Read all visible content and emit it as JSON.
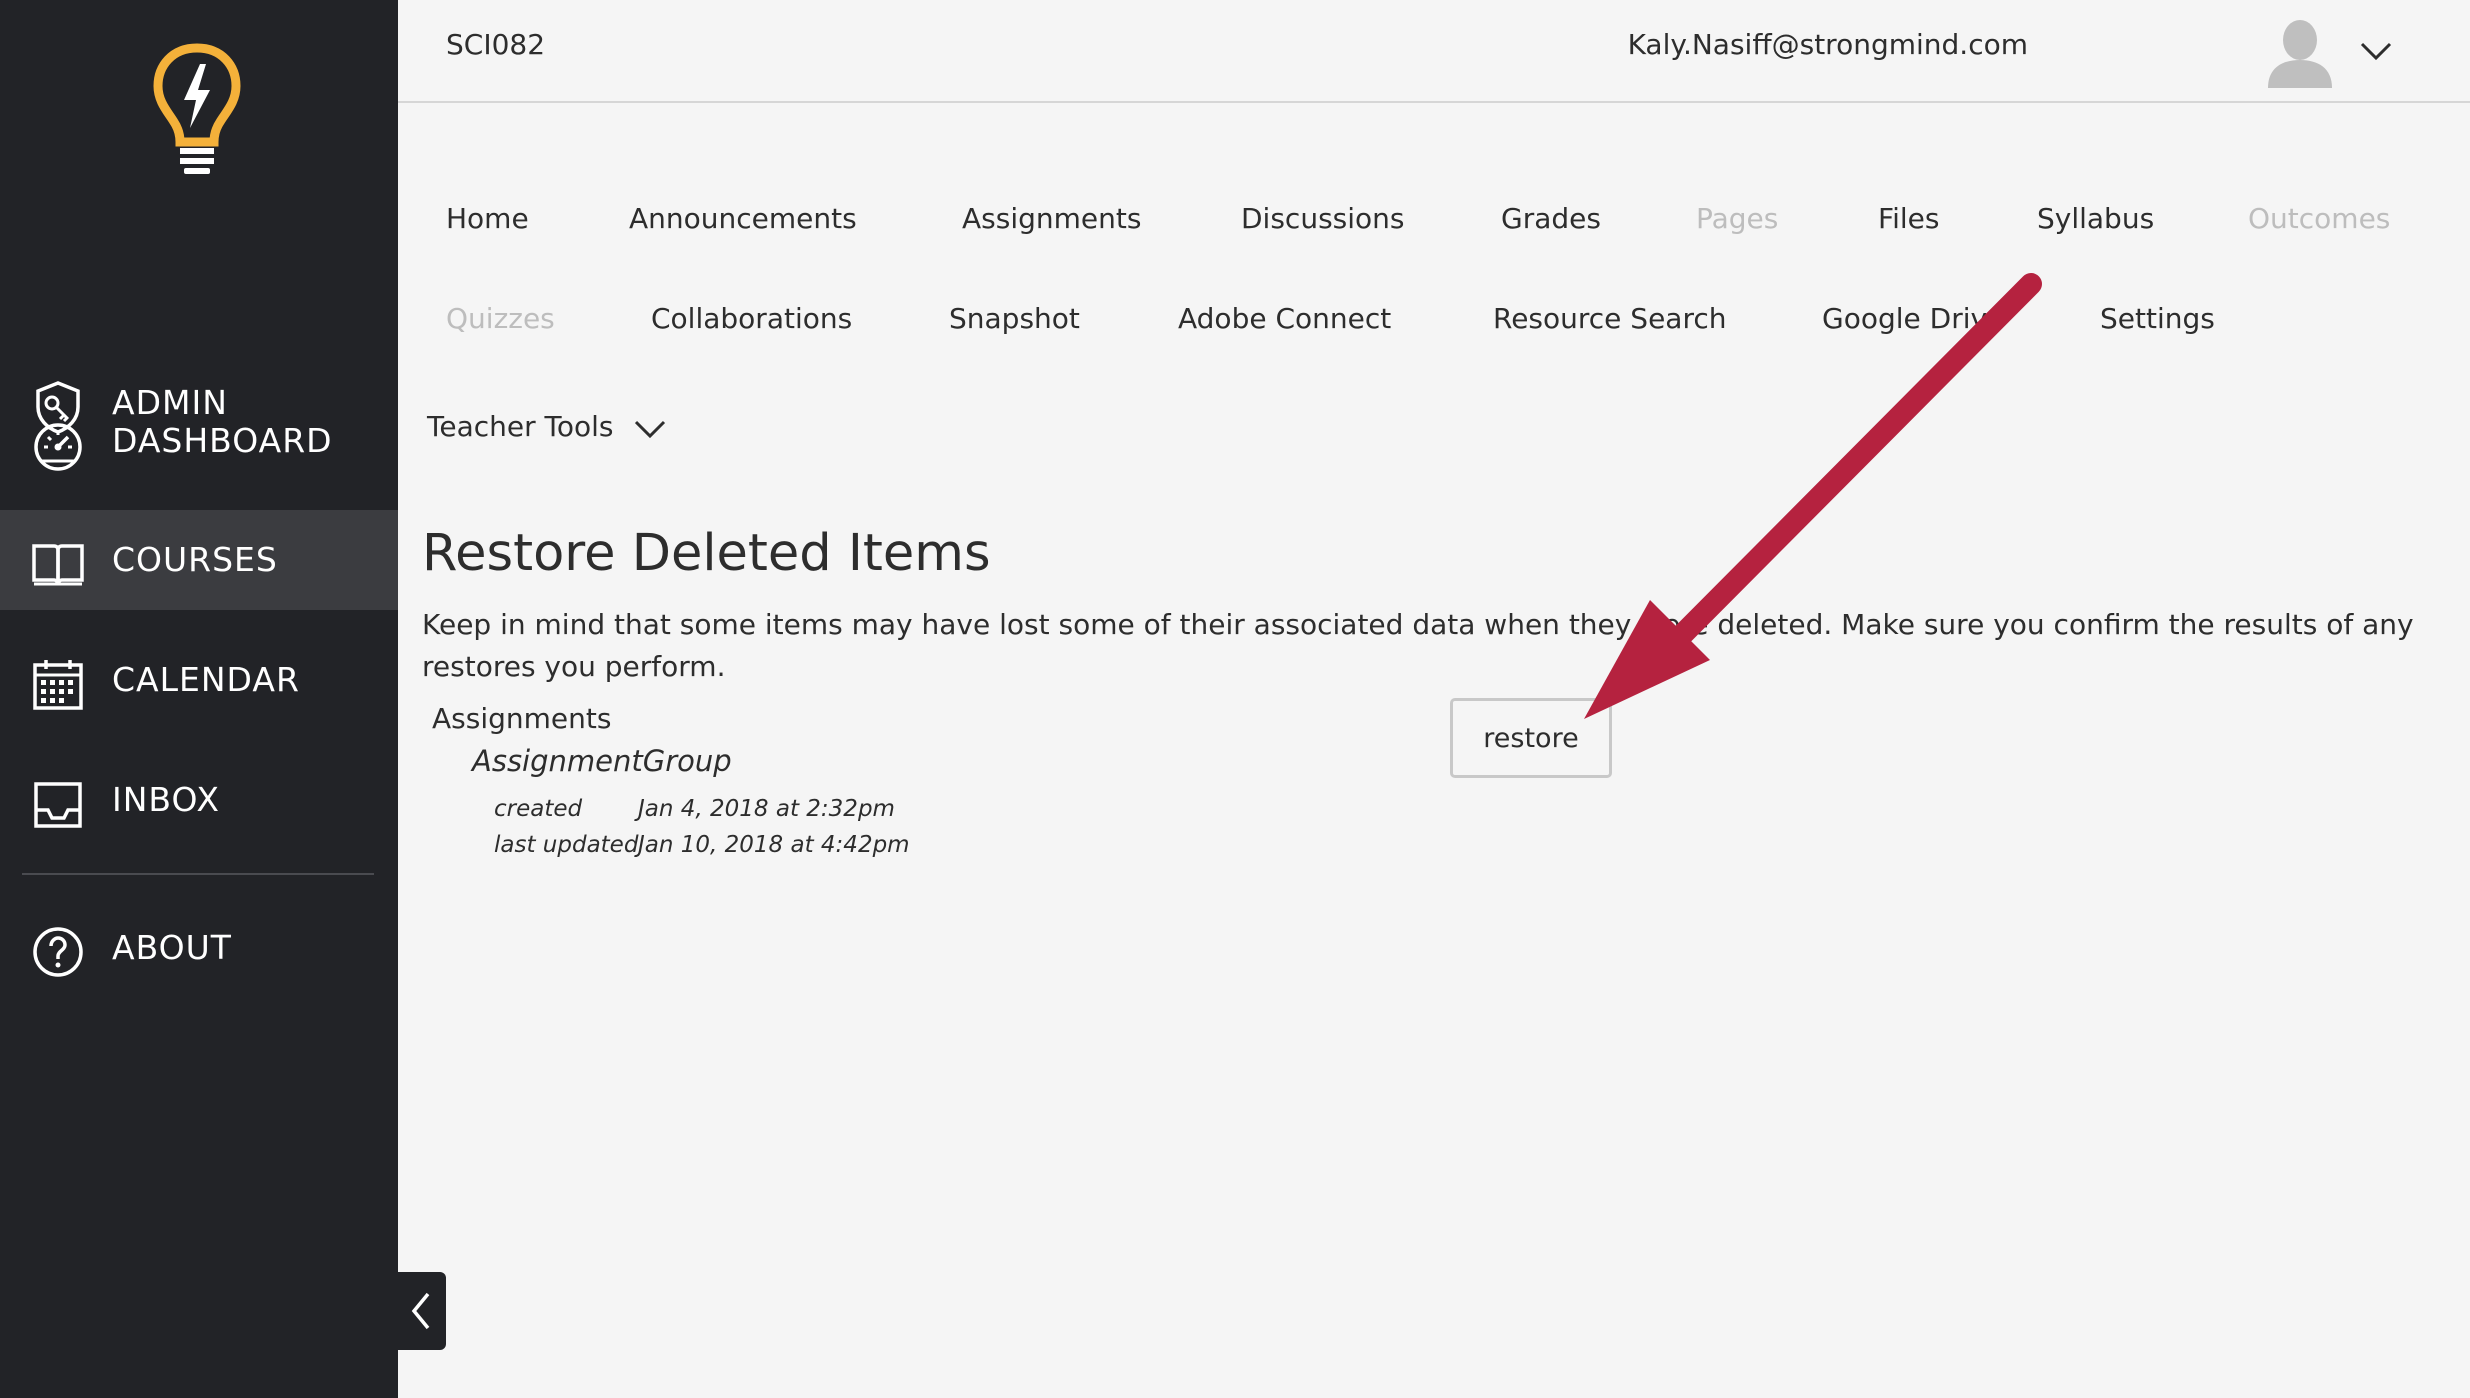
{
  "sidebar": {
    "items": [
      {
        "key": "admin",
        "label": "ADMIN",
        "icon": "shield-key-icon",
        "active": false
      },
      {
        "key": "dashboard",
        "label": "DASHBOARD",
        "icon": "speedometer-icon",
        "active": false
      },
      {
        "key": "courses",
        "label": "COURSES",
        "icon": "book-icon",
        "active": true
      },
      {
        "key": "calendar",
        "label": "CALENDAR",
        "icon": "calendar-icon",
        "active": false
      },
      {
        "key": "inbox",
        "label": "INBOX",
        "icon": "inbox-tray-icon",
        "active": false
      },
      {
        "key": "about",
        "label": "ABOUT",
        "icon": "question-circle-icon",
        "active": false
      }
    ],
    "logo_icon": "lightbulb-bolt-icon",
    "collapse_icon": "chevron-left-icon",
    "bg_color": "#222327",
    "active_bg_color": "#3b3c40",
    "logo_color": "#f4b13a"
  },
  "header": {
    "course_code": "SCI082",
    "user_email": "Kaly.Nasiff@strongmind.com",
    "avatar_icon": "user-silhouette-icon",
    "menu_icon": "chevron-down-icon"
  },
  "course_nav": {
    "row1": [
      {
        "label": "Home",
        "disabled": false
      },
      {
        "label": "Announcements",
        "disabled": false
      },
      {
        "label": "Assignments",
        "disabled": false
      },
      {
        "label": "Discussions",
        "disabled": false
      },
      {
        "label": "Grades",
        "disabled": false
      },
      {
        "label": "Pages",
        "disabled": true
      },
      {
        "label": "Files",
        "disabled": false
      },
      {
        "label": "Syllabus",
        "disabled": false
      },
      {
        "label": "Outcomes",
        "disabled": true
      }
    ],
    "row2": [
      {
        "label": "Quizzes",
        "disabled": true
      },
      {
        "label": "Collaborations",
        "disabled": false
      },
      {
        "label": "Snapshot",
        "disabled": false
      },
      {
        "label": "Adobe Connect",
        "disabled": false
      },
      {
        "label": "Resource Search",
        "disabled": false
      },
      {
        "label": "Google Drive",
        "disabled": false
      },
      {
        "label": "Settings",
        "disabled": false
      }
    ],
    "teacher_tools": "Teacher Tools"
  },
  "main": {
    "title": "Restore Deleted Items",
    "notice": "Keep in mind that some items may have lost some of their associated data when they were deleted. Make sure you confirm the results of any restores you perform.",
    "section": "Assignments",
    "item": {
      "name": "AssignmentGroup",
      "created_label": "created",
      "created_value": "Jan 4, 2018 at 2:32pm",
      "updated_label": "last updated",
      "updated_value": "Jan 10, 2018 at 4:42pm"
    },
    "restore_label": "restore"
  },
  "annotation": {
    "arrow_color": "#b5223f"
  }
}
